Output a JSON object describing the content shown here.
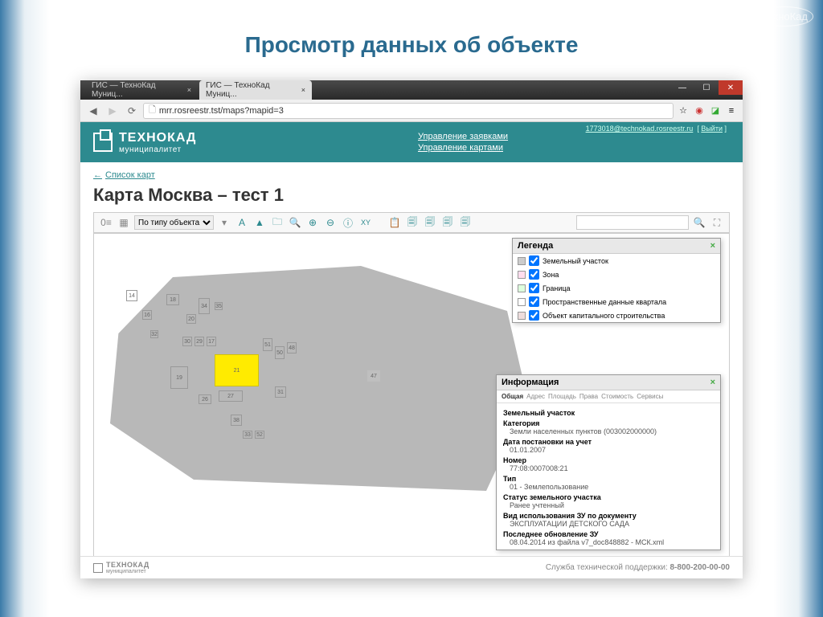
{
  "watermark": "ТехноКад",
  "slide_title": "Просмотр данных об объекте",
  "browser": {
    "tabs": [
      {
        "label": "ГИС — ТехноКад Муниц...",
        "active": false
      },
      {
        "label": "ГИС — ТехноКад Муниц...",
        "active": true
      }
    ],
    "url": "mrr.rosreestr.tst/maps?mapid=3"
  },
  "header": {
    "brand_top": "ТЕХНОКАД",
    "brand_bottom": "муниципалитет",
    "links": [
      "Управление заявками",
      "Управление картами"
    ],
    "user_email": "1773018@technokad.rosreestr.ru",
    "logout": "Выйти"
  },
  "page": {
    "back": "Список карт",
    "title": "Карта Москва – тест 1",
    "filter_label": "По типу объекта"
  },
  "toolbar_icons": [
    "A",
    "▲",
    "🗀",
    "🔍",
    "⊕",
    "⊖",
    "ⓘ",
    "XY",
    "📋",
    "🗐",
    "🗐",
    "🗐",
    "🗐"
  ],
  "legend": {
    "title": "Легенда",
    "items": [
      {
        "label": "Земельный участок",
        "color": "#ccc"
      },
      {
        "label": "Зона",
        "color": "#fde"
      },
      {
        "label": "Граница",
        "color": "#dfd"
      },
      {
        "label": "Пространственные данные квартала",
        "color": "#fff"
      },
      {
        "label": "Объект капитального строительства",
        "color": "#edd"
      }
    ]
  },
  "parcels": [
    "14",
    "16",
    "18",
    "20",
    "32",
    "34",
    "35",
    "30",
    "29",
    "17",
    "51",
    "50",
    "48",
    "21",
    "27",
    "26",
    "31",
    "38",
    "33",
    "52",
    "47",
    "19"
  ],
  "info": {
    "title": "Информация",
    "tabs": [
      "Общая",
      "Адрес",
      "Площадь",
      "Права",
      "Стоимость",
      "Сервисы"
    ],
    "heading": "Земельный участок",
    "fields": [
      {
        "label": "Категория",
        "value": "Земли населенных пунктов (003002000000)"
      },
      {
        "label": "Дата постановки на учет",
        "value": "01.01.2007"
      },
      {
        "label": "Номер",
        "value": "77:08:0007008:21"
      },
      {
        "label": "Тип",
        "value": "01 - Землепользование"
      },
      {
        "label": "Статус земельного участка",
        "value": "Ранее учтенный"
      },
      {
        "label": "Вид использования ЗУ по документу",
        "value": "ЭКСПЛУАТАЦИИ ДЕТСКОГО САДА"
      },
      {
        "label": "Последнее обновление ЗУ",
        "value": "08.04.2014 из файла v7_doc848882 - МСК.xml"
      }
    ]
  },
  "footer": {
    "brand": "ТЕХНОКАД",
    "brand_sub": "муниципалитет",
    "support": "Служба технической поддержки:",
    "phone": "8-800-200-00-00"
  }
}
